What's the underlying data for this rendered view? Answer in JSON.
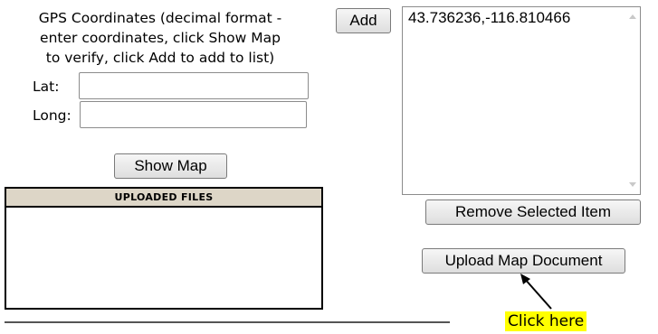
{
  "gps": {
    "instructions_line1": "GPS Coordinates (decimal format -",
    "instructions_line2": "enter coordinates, click Show Map",
    "instructions_line3": "to verify, click Add to add to list)",
    "lat_label": "Lat:",
    "lat_value": "",
    "long_label": "Long:",
    "long_value": ""
  },
  "buttons": {
    "add": "Add",
    "show_map": "Show Map",
    "remove_selected": "Remove Selected Item",
    "upload_map": "Upload Map Document"
  },
  "coordinates_list": {
    "items": [
      "43.736236,-116.810466"
    ]
  },
  "uploaded_files": {
    "header": "UPLOADED FILES"
  },
  "annotation": {
    "text": "Click here",
    "highlight_color": "#ffff00"
  }
}
